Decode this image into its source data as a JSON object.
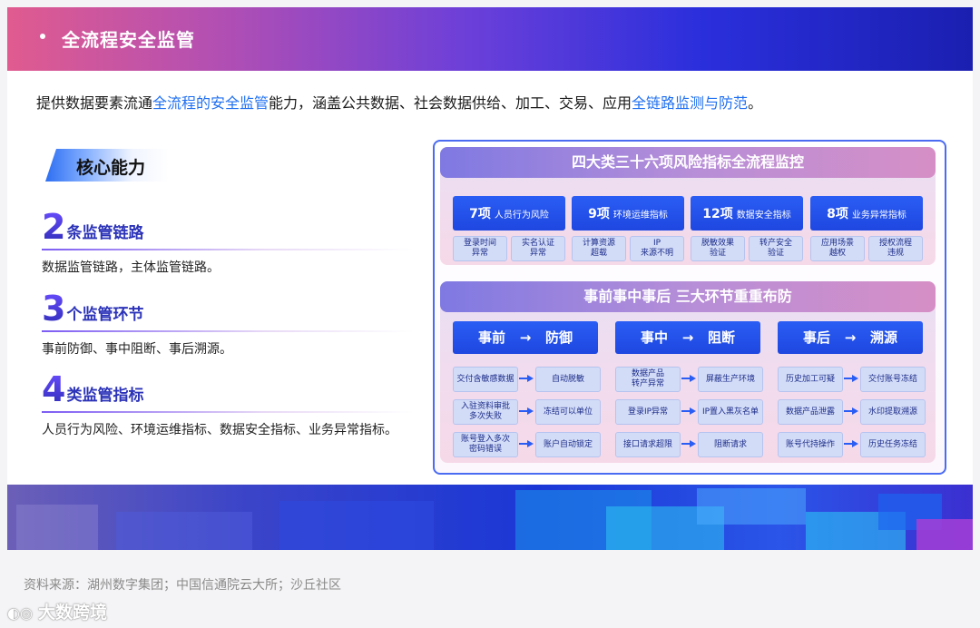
{
  "header": {
    "title": "全流程安全监管"
  },
  "intro": {
    "p1": "提供数据要素流通",
    "h1": "全流程的安全监管",
    "p2": "能力，涵盖公共数据、社会数据供给、加工、交易、应用",
    "h2": "全链路监测与防范",
    "p3": "。"
  },
  "capability": {
    "tag": "核心能力",
    "items": [
      {
        "num": "2",
        "label": "条监管链路",
        "desc": "数据监管链路，主体监管链路。"
      },
      {
        "num": "3",
        "label": "个监管环节",
        "desc": "事前防御、事中阻断、事后溯源。"
      },
      {
        "num": "4",
        "label": "类监管指标",
        "desc": "人员行为风险、环境运维指标、数据安全指标、业务异常指标。"
      }
    ]
  },
  "monitor": {
    "title": "四大类三十六项风险指标全流程监控",
    "groups": [
      {
        "count": "7项",
        "name": "人员行为风险",
        "subs": [
          "登录时间\n异常",
          "实名认证\n异常"
        ]
      },
      {
        "count": "9项",
        "name": "环境运维指标",
        "subs": [
          "计算资源\n超载",
          "IP\n来源不明"
        ]
      },
      {
        "count": "12项",
        "name": "数据安全指标",
        "subs": [
          "脱敏效果\n验证",
          "转产安全\n验证"
        ]
      },
      {
        "count": "8项",
        "name": "业务异常指标",
        "subs": [
          "应用场景\n越权",
          "授权流程\n违规"
        ]
      }
    ]
  },
  "defense": {
    "title": "事前事中事后  三大环节重重布防",
    "phases": [
      {
        "label": "事前   →   防御",
        "rows": [
          [
            "交付含敏感数据",
            "自动脱敏"
          ],
          [
            "入驻资料审批\n多次失败",
            "冻结可以单位"
          ],
          [
            "账号登入多次\n密码错误",
            "账户自动锁定"
          ]
        ]
      },
      {
        "label": "事中   →   阻断",
        "rows": [
          [
            "数据产品\n转产异常",
            "屏蔽生产环境"
          ],
          [
            "登录IP异常",
            "IP置入黑灰名单"
          ],
          [
            "接口请求超限",
            "阻断请求"
          ]
        ]
      },
      {
        "label": "事后   →   溯源",
        "rows": [
          [
            "历史加工可疑",
            "交付账号冻结"
          ],
          [
            "数据产品泄露",
            "水印提取溯源"
          ],
          [
            "账号代持操作",
            "历史任务冻结"
          ]
        ]
      }
    ]
  },
  "footer": {
    "source": "资料来源：湖州数字集团；中国信通院云大所；沙丘社区",
    "watermark": "大数跨境"
  },
  "colors": {
    "accent": "#2a5df4",
    "highlight": "#1f6ff0",
    "banner_start": "#e05b8f",
    "banner_end": "#1b1fb0"
  }
}
